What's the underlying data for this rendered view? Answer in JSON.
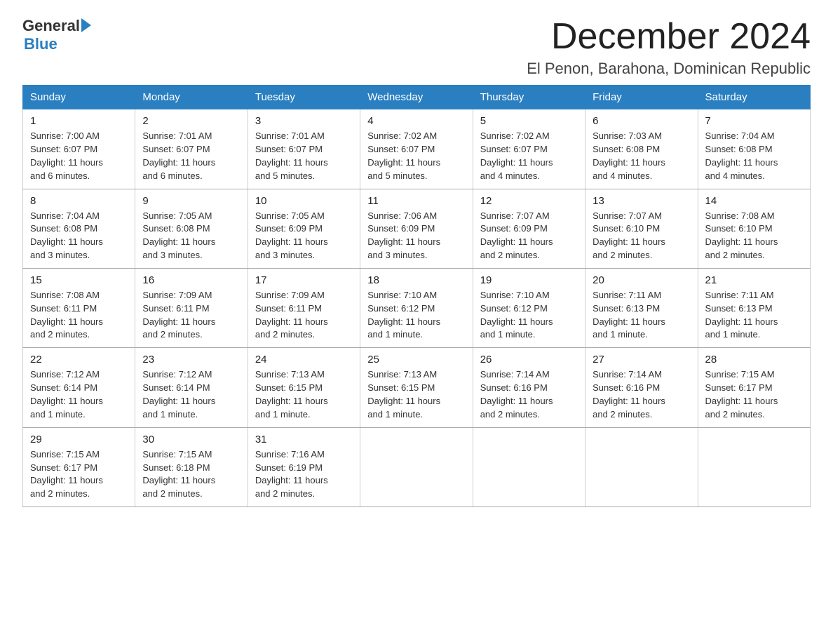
{
  "logo": {
    "general": "General",
    "blue": "Blue",
    "line2": "Blue"
  },
  "title": {
    "month": "December 2024",
    "location": "El Penon, Barahona, Dominican Republic"
  },
  "days_of_week": [
    "Sunday",
    "Monday",
    "Tuesday",
    "Wednesday",
    "Thursday",
    "Friday",
    "Saturday"
  ],
  "weeks": [
    [
      {
        "day": "1",
        "info": "Sunrise: 7:00 AM\nSunset: 6:07 PM\nDaylight: 11 hours\nand 6 minutes."
      },
      {
        "day": "2",
        "info": "Sunrise: 7:01 AM\nSunset: 6:07 PM\nDaylight: 11 hours\nand 6 minutes."
      },
      {
        "day": "3",
        "info": "Sunrise: 7:01 AM\nSunset: 6:07 PM\nDaylight: 11 hours\nand 5 minutes."
      },
      {
        "day": "4",
        "info": "Sunrise: 7:02 AM\nSunset: 6:07 PM\nDaylight: 11 hours\nand 5 minutes."
      },
      {
        "day": "5",
        "info": "Sunrise: 7:02 AM\nSunset: 6:07 PM\nDaylight: 11 hours\nand 4 minutes."
      },
      {
        "day": "6",
        "info": "Sunrise: 7:03 AM\nSunset: 6:08 PM\nDaylight: 11 hours\nand 4 minutes."
      },
      {
        "day": "7",
        "info": "Sunrise: 7:04 AM\nSunset: 6:08 PM\nDaylight: 11 hours\nand 4 minutes."
      }
    ],
    [
      {
        "day": "8",
        "info": "Sunrise: 7:04 AM\nSunset: 6:08 PM\nDaylight: 11 hours\nand 3 minutes."
      },
      {
        "day": "9",
        "info": "Sunrise: 7:05 AM\nSunset: 6:08 PM\nDaylight: 11 hours\nand 3 minutes."
      },
      {
        "day": "10",
        "info": "Sunrise: 7:05 AM\nSunset: 6:09 PM\nDaylight: 11 hours\nand 3 minutes."
      },
      {
        "day": "11",
        "info": "Sunrise: 7:06 AM\nSunset: 6:09 PM\nDaylight: 11 hours\nand 3 minutes."
      },
      {
        "day": "12",
        "info": "Sunrise: 7:07 AM\nSunset: 6:09 PM\nDaylight: 11 hours\nand 2 minutes."
      },
      {
        "day": "13",
        "info": "Sunrise: 7:07 AM\nSunset: 6:10 PM\nDaylight: 11 hours\nand 2 minutes."
      },
      {
        "day": "14",
        "info": "Sunrise: 7:08 AM\nSunset: 6:10 PM\nDaylight: 11 hours\nand 2 minutes."
      }
    ],
    [
      {
        "day": "15",
        "info": "Sunrise: 7:08 AM\nSunset: 6:11 PM\nDaylight: 11 hours\nand 2 minutes."
      },
      {
        "day": "16",
        "info": "Sunrise: 7:09 AM\nSunset: 6:11 PM\nDaylight: 11 hours\nand 2 minutes."
      },
      {
        "day": "17",
        "info": "Sunrise: 7:09 AM\nSunset: 6:11 PM\nDaylight: 11 hours\nand 2 minutes."
      },
      {
        "day": "18",
        "info": "Sunrise: 7:10 AM\nSunset: 6:12 PM\nDaylight: 11 hours\nand 1 minute."
      },
      {
        "day": "19",
        "info": "Sunrise: 7:10 AM\nSunset: 6:12 PM\nDaylight: 11 hours\nand 1 minute."
      },
      {
        "day": "20",
        "info": "Sunrise: 7:11 AM\nSunset: 6:13 PM\nDaylight: 11 hours\nand 1 minute."
      },
      {
        "day": "21",
        "info": "Sunrise: 7:11 AM\nSunset: 6:13 PM\nDaylight: 11 hours\nand 1 minute."
      }
    ],
    [
      {
        "day": "22",
        "info": "Sunrise: 7:12 AM\nSunset: 6:14 PM\nDaylight: 11 hours\nand 1 minute."
      },
      {
        "day": "23",
        "info": "Sunrise: 7:12 AM\nSunset: 6:14 PM\nDaylight: 11 hours\nand 1 minute."
      },
      {
        "day": "24",
        "info": "Sunrise: 7:13 AM\nSunset: 6:15 PM\nDaylight: 11 hours\nand 1 minute."
      },
      {
        "day": "25",
        "info": "Sunrise: 7:13 AM\nSunset: 6:15 PM\nDaylight: 11 hours\nand 1 minute."
      },
      {
        "day": "26",
        "info": "Sunrise: 7:14 AM\nSunset: 6:16 PM\nDaylight: 11 hours\nand 2 minutes."
      },
      {
        "day": "27",
        "info": "Sunrise: 7:14 AM\nSunset: 6:16 PM\nDaylight: 11 hours\nand 2 minutes."
      },
      {
        "day": "28",
        "info": "Sunrise: 7:15 AM\nSunset: 6:17 PM\nDaylight: 11 hours\nand 2 minutes."
      }
    ],
    [
      {
        "day": "29",
        "info": "Sunrise: 7:15 AM\nSunset: 6:17 PM\nDaylight: 11 hours\nand 2 minutes."
      },
      {
        "day": "30",
        "info": "Sunrise: 7:15 AM\nSunset: 6:18 PM\nDaylight: 11 hours\nand 2 minutes."
      },
      {
        "day": "31",
        "info": "Sunrise: 7:16 AM\nSunset: 6:19 PM\nDaylight: 11 hours\nand 2 minutes."
      },
      {
        "day": "",
        "info": ""
      },
      {
        "day": "",
        "info": ""
      },
      {
        "day": "",
        "info": ""
      },
      {
        "day": "",
        "info": ""
      }
    ]
  ]
}
